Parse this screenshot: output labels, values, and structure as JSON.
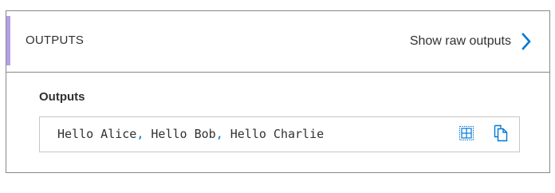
{
  "header": {
    "title": "OUTPUTS",
    "raw_link_label": "Show raw outputs",
    "accent_color": "#b4a0e6"
  },
  "outputs": {
    "label": "Outputs",
    "values": [
      "Hello Alice",
      "Hello Bob",
      "Hello Charlie"
    ],
    "separator": ", "
  },
  "icons": {
    "chevron": "chevron-right-icon",
    "table": "table-view-icon",
    "copy": "copy-icon",
    "link_color": "#0078d4"
  }
}
